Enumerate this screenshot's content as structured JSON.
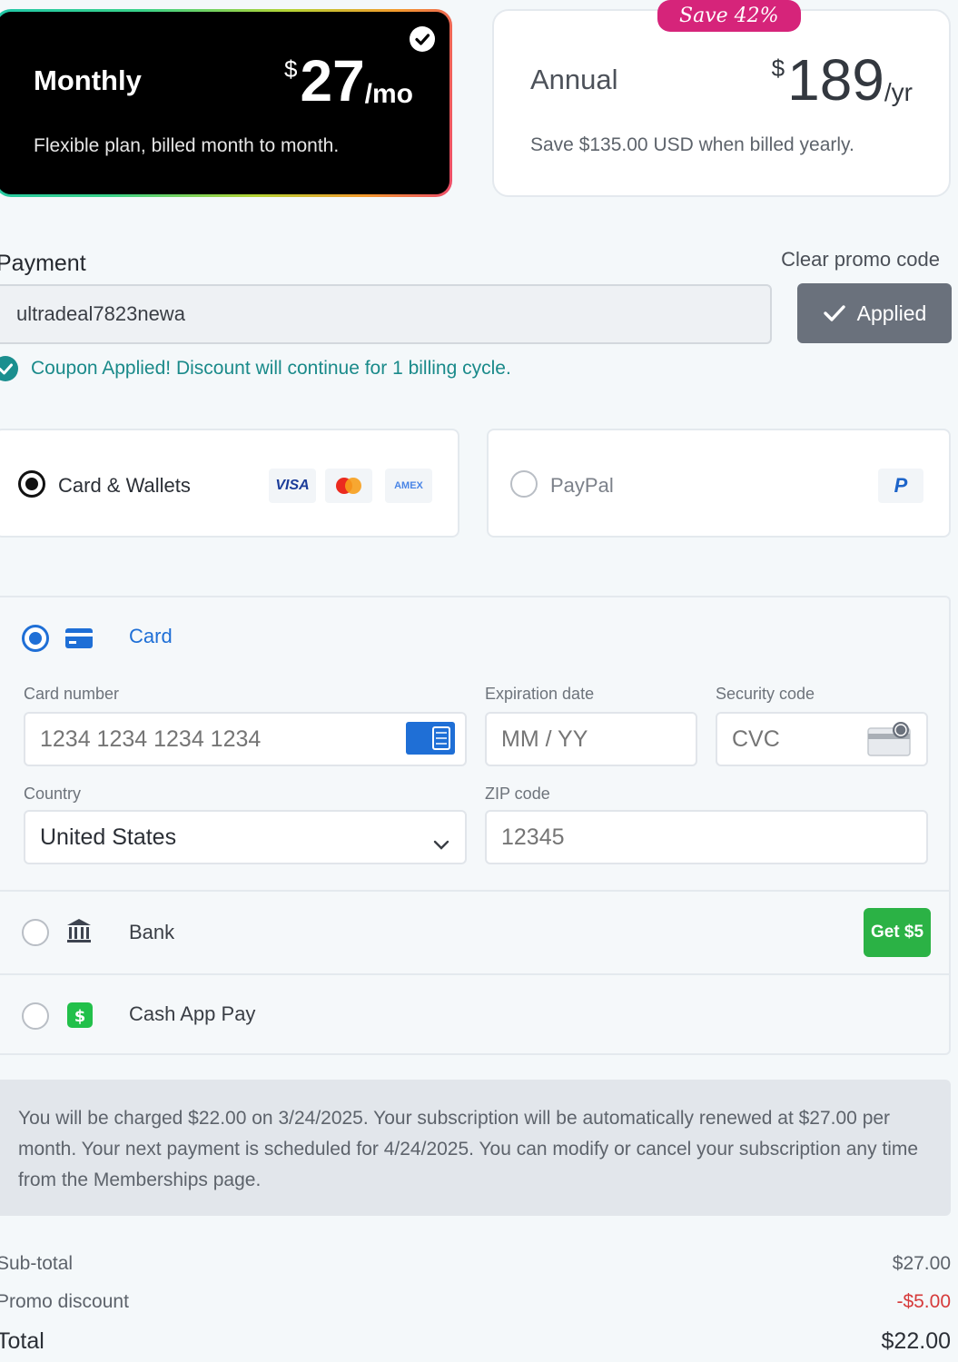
{
  "plans": {
    "monthly": {
      "name": "Monthly",
      "currency": "$",
      "amount": "27",
      "period": "/mo",
      "description": "Flexible plan, billed month to month."
    },
    "annual": {
      "name": "Annual",
      "currency": "$",
      "amount": "189",
      "period": "/yr",
      "description": "Save $135.00 USD when billed yearly.",
      "badge": "Save 42%"
    }
  },
  "payment": {
    "title": "Payment",
    "clear_promo": "Clear promo code",
    "promo_value": "ultradeal7823newa",
    "applied_label": "Applied",
    "coupon_message": "Coupon Applied! Discount will continue for 1 billing cycle."
  },
  "methods": {
    "card_wallets": "Card & Wallets",
    "visa": "VISA",
    "amex": "AMEX",
    "paypal": "PayPal",
    "paypal_logo": "P"
  },
  "card_form": {
    "card_option": "Card",
    "card_number_label": "Card number",
    "card_number_placeholder": "1234 1234 1234 1234",
    "expiry_label": "Expiration date",
    "expiry_placeholder": "MM / YY",
    "cvc_label": "Security code",
    "cvc_placeholder": "CVC",
    "country_label": "Country",
    "country_value": "United States",
    "zip_label": "ZIP code",
    "zip_placeholder": "12345",
    "bank_option": "Bank",
    "bank_badge": "Get $5",
    "cashapp_option": "Cash App Pay"
  },
  "info_text": "You will be charged $22.00 on 3/24/2025. Your subscription will be automatically renewed at $27.00 per month. Your next payment is scheduled for 4/24/2025. You can modify or cancel your subscription any time from the Memberships page.",
  "totals": {
    "subtotal_label": "Sub-total",
    "subtotal_value": "$27.00",
    "discount_label": "Promo discount",
    "discount_value": "-$5.00",
    "total_label": "Total",
    "total_value": "$22.00"
  },
  "colors": {
    "accent_blue": "#1f6fd6",
    "teal": "#1a8a8a",
    "pink": "#d6247a",
    "green": "#2bb245",
    "red": "#d63b3b"
  }
}
